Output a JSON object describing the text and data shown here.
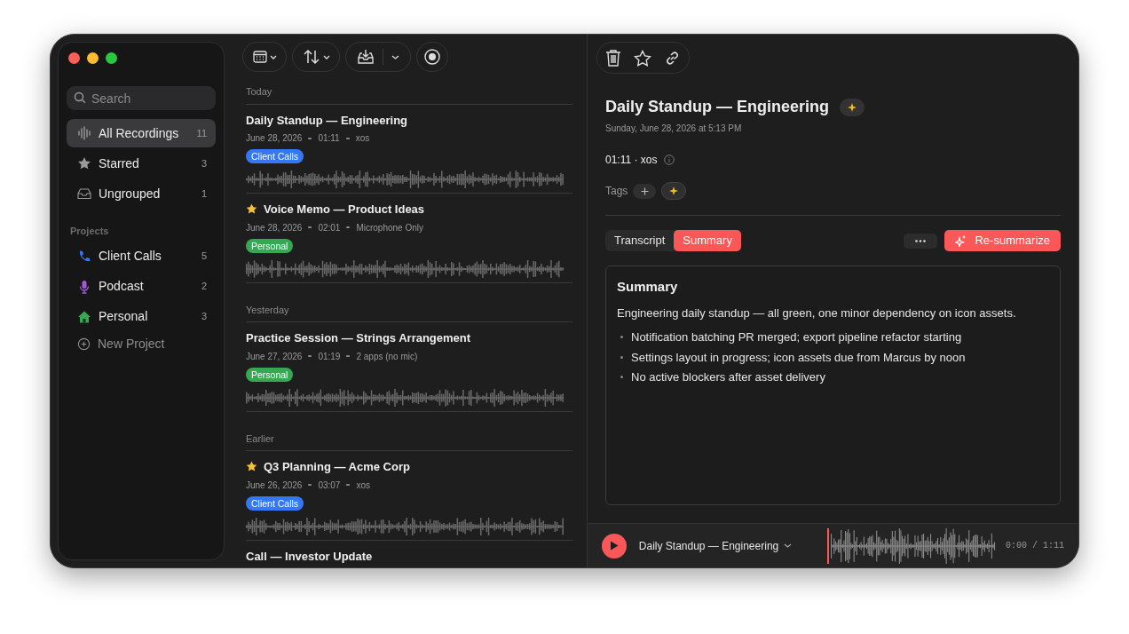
{
  "sidebar": {
    "search": {
      "placeholder": "Search"
    },
    "items": [
      {
        "kind": "waveform",
        "label": "All Recordings",
        "count": "11",
        "selected": true
      },
      {
        "kind": "star",
        "label": "Starred",
        "count": "3",
        "selected": false
      },
      {
        "kind": "tray",
        "label": "Ungrouped",
        "count": "1",
        "selected": false
      }
    ],
    "projects_heading": "Projects",
    "projects": [
      {
        "kind": "phone",
        "label": "Client Calls",
        "count": "5",
        "color": "#3478f6",
        "selected": false
      },
      {
        "kind": "mic",
        "label": "Podcast",
        "count": "2",
        "color": "#a259d9",
        "selected": false
      },
      {
        "kind": "house",
        "label": "Personal",
        "count": "3",
        "color": "#34a853",
        "selected": false
      }
    ],
    "new_project": "New Project"
  },
  "list": {
    "groups": [
      {
        "heading": "Today",
        "recordings": [
          {
            "title": "Daily Standup — Engineering",
            "starred": false,
            "date": "June 28, 2026",
            "duration": "01:11",
            "source": "xos",
            "tag": {
              "label": "Client Calls",
              "color": "#3478f6"
            }
          },
          {
            "title": "Voice Memo — Product Ideas",
            "starred": true,
            "date": "June 28, 2026",
            "duration": "02:01",
            "source": "Microphone Only",
            "tag": {
              "label": "Personal",
              "color": "#34a853"
            }
          }
        ]
      },
      {
        "heading": "Yesterday",
        "recordings": [
          {
            "title": "Practice Session — Strings Arrangement",
            "starred": false,
            "date": "June 27, 2026",
            "duration": "01:19",
            "source": "2 apps (no mic)",
            "tag": {
              "label": "Personal",
              "color": "#34a853"
            }
          }
        ]
      },
      {
        "heading": "Earlier",
        "recordings": [
          {
            "title": "Q3 Planning — Acme Corp",
            "starred": true,
            "date": "June 26, 2026",
            "duration": "03:07",
            "source": "xos",
            "tag": {
              "label": "Client Calls",
              "color": "#3478f6"
            }
          },
          {
            "title": "Call — Investor Update",
            "starred": false
          }
        ]
      }
    ]
  },
  "detail": {
    "title": "Daily Standup — Engineering",
    "date": "Sunday, June 28, 2026 at 5:13 PM",
    "meta": "01:11 · xos",
    "tags_label": "Tags",
    "tabs": [
      {
        "label": "Transcript",
        "selected": false
      },
      {
        "label": "Summary",
        "selected": true
      }
    ],
    "action": "Re-summarize",
    "summary": {
      "heading": "Summary",
      "intro": "Engineering daily standup — all green, one minor dependency on icon assets.",
      "bullets": [
        "Notification batching PR merged; export pipeline refactor starting",
        "Settings layout in progress; icon assets due from Marcus by noon",
        "No active blockers after asset delivery"
      ]
    }
  },
  "player": {
    "title": "Daily Standup — Engineering",
    "time": "0:00 / 1:11",
    "level": 0
  }
}
